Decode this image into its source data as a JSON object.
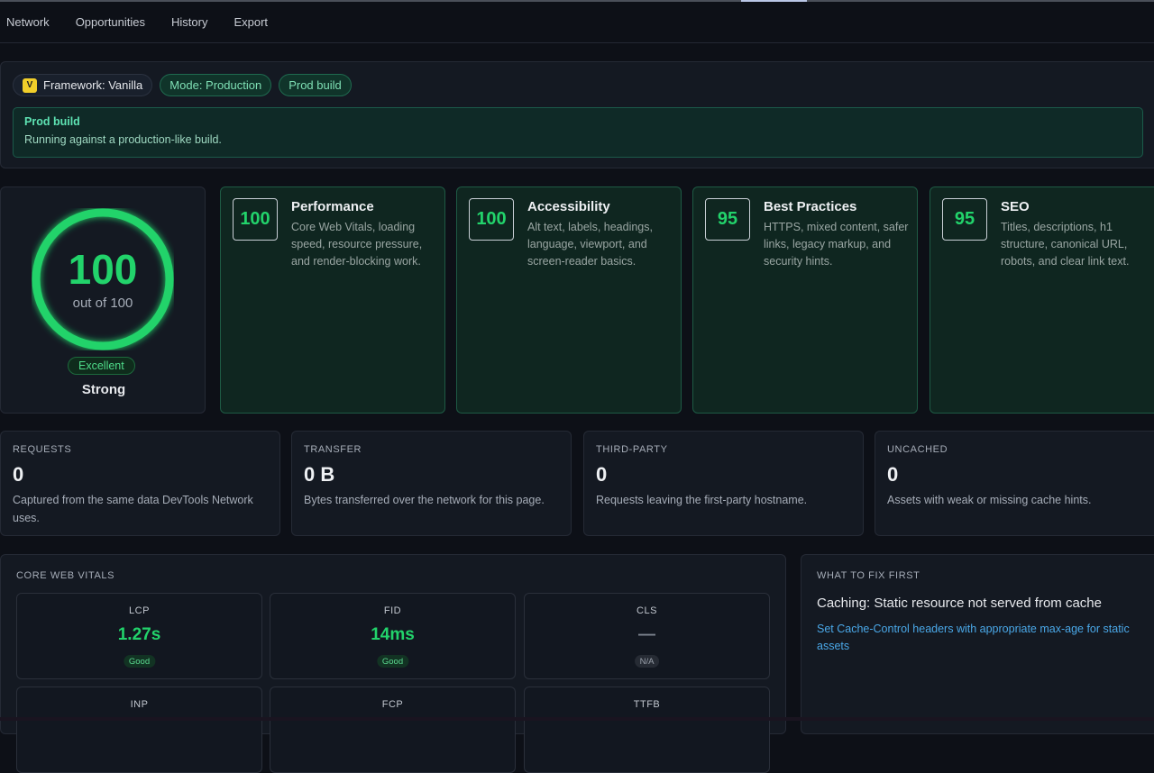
{
  "nav": {
    "tabs": [
      "Network",
      "Opportunities",
      "History",
      "Export"
    ]
  },
  "framework": {
    "badge_letter": "V",
    "chips": {
      "framework": "Framework: Vanilla",
      "mode": "Mode: Production",
      "build": "Prod build"
    },
    "notice_title": "Prod build",
    "notice_text": "Running against a production-like build."
  },
  "overall": {
    "score": "100",
    "out_of": "out of 100",
    "rating": "Excellent",
    "verdict": "Strong",
    "ring_color": "#22d36b"
  },
  "categories": [
    {
      "score": "100",
      "title": "Performance",
      "desc": "Core Web Vitals, loading speed, resource pressure, and render-blocking work."
    },
    {
      "score": "100",
      "title": "Accessibility",
      "desc": "Alt text, labels, headings, language, viewport, and screen-reader basics."
    },
    {
      "score": "95",
      "title": "Best Practices",
      "desc": "HTTPS, mixed content, safer links, legacy markup, and security hints."
    },
    {
      "score": "95",
      "title": "SEO",
      "desc": "Titles, descriptions, h1 structure, canonical URL, robots, and clear link text."
    }
  ],
  "stats": [
    {
      "label": "REQUESTS",
      "value": "0",
      "desc": "Captured from the same data DevTools Network uses."
    },
    {
      "label": "TRANSFER",
      "value": "0 B",
      "desc": "Bytes transferred over the network for this page."
    },
    {
      "label": "THIRD-PARTY",
      "value": "0",
      "desc": "Requests leaving the first-party hostname."
    },
    {
      "label": "UNCACHED",
      "value": "0",
      "desc": "Assets with weak or missing cache hints."
    }
  ],
  "vitals": {
    "heading": "CORE WEB VITALS",
    "metrics": [
      {
        "name": "LCP",
        "value": "1.27s",
        "badge": "Good"
      },
      {
        "name": "FID",
        "value": "14ms",
        "badge": "Good"
      },
      {
        "name": "CLS",
        "value": "—",
        "badge": "N/A"
      },
      {
        "name": "INP"
      },
      {
        "name": "FCP"
      },
      {
        "name": "TTFB"
      }
    ]
  },
  "fix_first": {
    "heading": "WHAT TO FIX FIRST",
    "title": "Caching: Static resource not served from cache",
    "desc": "Set Cache-Control headers with appropriate max-age for static assets"
  }
}
